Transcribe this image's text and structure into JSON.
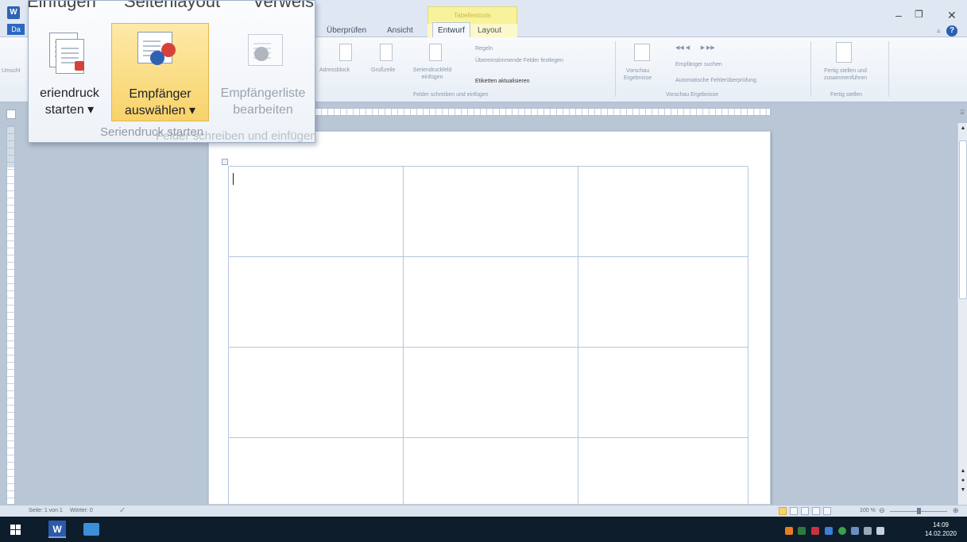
{
  "window": {
    "app_icon": "word-app-icon",
    "file_tab": "Da",
    "tabs": [
      "Überprüfen",
      "Ansicht",
      "Entwurf",
      "Layout"
    ],
    "context_group": "Tabellentools",
    "controls": {
      "minimize": "–",
      "restore": "❐",
      "close": "✕"
    }
  },
  "ribbon": {
    "left_cut": "Umschl",
    "groups": [
      {
        "label": "Felder schreiben und einfügen",
        "items": [
          "Adressblock",
          "Grußzeile",
          "Seriendruckfeld einfügen",
          "Regeln",
          "Übereinstimmende Felder festlegen",
          "Etiketten aktualisieren"
        ]
      },
      {
        "label": "Vorschau Ergebnisse",
        "items": [
          "Vorschau Ergebnisse",
          "Empfänger suchen",
          "Automatische Fehlerüberprüfung"
        ]
      },
      {
        "label": "Fertig stellen",
        "items": [
          "Fertig stellen und zusammenführen"
        ]
      }
    ]
  },
  "popup": {
    "tabs": [
      "Einfügen",
      "Seitenlayout",
      "Verweise"
    ],
    "buttons": [
      {
        "line1": "eriendruck",
        "line2": "starten ▾",
        "enabled": true,
        "highlighted": false,
        "icon": "merge-doc-icon"
      },
      {
        "line1": "Empfänger",
        "line2": "auswählen ▾",
        "enabled": true,
        "highlighted": true,
        "icon": "select-recipients-icon"
      },
      {
        "line1": "Empfängerliste",
        "line2": "bearbeiten",
        "enabled": false,
        "highlighted": false,
        "icon": "edit-recipient-list-icon"
      }
    ],
    "group_label": "Seriendruck starten",
    "ghost_label": "Felder schreiben und einfügen"
  },
  "document": {
    "label_rows": 4,
    "label_cols": 3
  },
  "statusbar": {
    "page": "Seite: 1 von 1",
    "words": "Wörter: 0",
    "zoom": "100 %"
  },
  "taskbar": {
    "time": "14:09",
    "date": "14.02.2020"
  },
  "colors": {
    "highlight": "#f8d36b",
    "word_blue": "#2b5aaa",
    "workspace": "#b9c6d6"
  }
}
